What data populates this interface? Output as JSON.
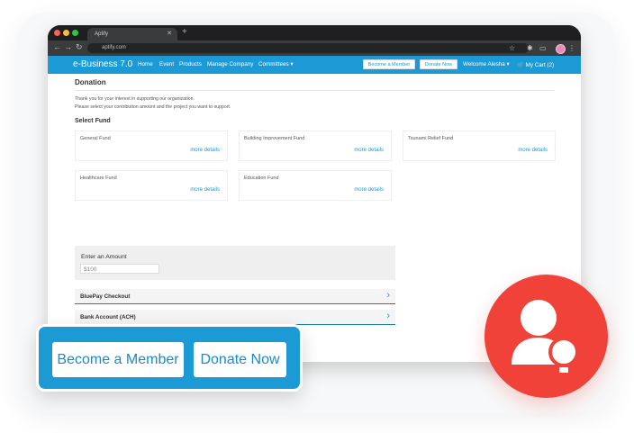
{
  "browser": {
    "tab_title": "Aptify",
    "url": "aptify.com"
  },
  "app": {
    "brand": "e-Business 7.0",
    "nav": [
      "Home",
      "Event",
      "Products",
      "Manage Company",
      "Committees"
    ],
    "become_member_label": "Become a Member",
    "donate_now_label": "Donate Now",
    "welcome": "Welcome Alesha",
    "cart": "My Cart (2)"
  },
  "donation": {
    "title": "Donation",
    "intro_line1": "Thank you for your interest in supporting our organization.",
    "intro_line2": "Please select your contribution amount and the project you want to support.",
    "select_fund": "Select Fund",
    "funds": [
      {
        "name": "General Fund",
        "link": "more details"
      },
      {
        "name": "Building Improvement Fund",
        "link": "more details"
      },
      {
        "name": "Tsunami Relief Fund",
        "link": "more details"
      },
      {
        "name": "Healthcare Fund",
        "link": "more details"
      },
      {
        "name": "Education Fund",
        "link": "more details"
      }
    ],
    "amount_label": "Enter an Amount",
    "amount_value": "$100",
    "payment_methods": [
      "BluePay Checkout",
      "Bank Account (ACH)"
    ]
  },
  "overlay": {
    "become_member_label": "Become a Member",
    "donate_now_label": "Donate Now"
  },
  "colors": {
    "accent": "#1b9ad6",
    "badge": "#f04238"
  },
  "icons": {
    "badge_icon": "user-lightbulb-icon"
  }
}
